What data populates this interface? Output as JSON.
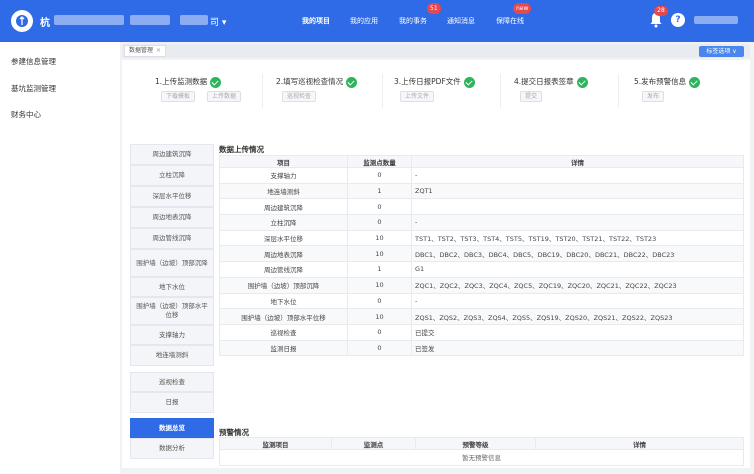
{
  "header": {
    "org_name": "杭",
    "org_suffix": "司 ▾",
    "nav": [
      "我的项目",
      "我的应用",
      "我的事务",
      "通知消息",
      "保障在线"
    ],
    "badges": {
      "affairs": "51",
      "online": "new"
    },
    "bell_count": "28",
    "help": "?"
  },
  "sidebar": {
    "items": [
      "参建信息管理",
      "基坑监测管理",
      "财务中心"
    ]
  },
  "tabs": {
    "active": "数据管理",
    "close": "×",
    "tag_option": "标签选项 ∨"
  },
  "steps": [
    {
      "title": "1.上传监测数据",
      "buttons": [
        "下载模板",
        "上传数据"
      ]
    },
    {
      "title": "2.填写巡视检查情况",
      "buttons": [
        "巡视检查"
      ]
    },
    {
      "title": "3.上传日报PDF文件",
      "buttons": [
        "上传文件"
      ]
    },
    {
      "title": "4.提交日报表签章",
      "buttons": [
        "提交"
      ]
    },
    {
      "title": "5.发布预警信息",
      "buttons": [
        "发布"
      ]
    }
  ],
  "left_menu": [
    "周边建筑沉降",
    "立柱沉降",
    "深层水平位移",
    "周边地表沉降",
    "周边管线沉降",
    "围护墙（边坡）顶部沉降",
    "地下水位",
    "围护墙（边坡）顶部水平位移",
    "支撑轴力",
    "地连墙测斜",
    "巡视检查",
    "日报",
    "数据总览",
    "数据分析"
  ],
  "upload": {
    "title": "数据上传情况",
    "headers": [
      "项目",
      "监测点数量",
      "详情"
    ],
    "rows": [
      [
        "支撑轴力",
        "0",
        "-"
      ],
      [
        "地连墙测斜",
        "1",
        "ZQT1"
      ],
      [
        "周边建筑沉降",
        "0",
        ""
      ],
      [
        "立柱沉降",
        "0",
        "-"
      ],
      [
        "深层水平位移",
        "10",
        "TST1、TST2、TST3、TST4、TST5、TST19、TST20、TST21、TST22、TST23"
      ],
      [
        "周边地表沉降",
        "10",
        "DBC1、DBC2、DBC3、DBC4、DBC5、DBC19、DBC20、DBC21、DBC22、DBC23"
      ],
      [
        "周边管线沉降",
        "1",
        "G1"
      ],
      [
        "围护墙（边坡）顶部沉降",
        "10",
        "ZQC1、ZQC2、ZQC3、ZQC4、ZQC5、ZQC19、ZQC20、ZQC21、ZQC22、ZQC23"
      ],
      [
        "地下水位",
        "0",
        "-"
      ],
      [
        "围护墙（边坡）顶部水平位移",
        "10",
        "ZQS1、ZQS2、ZQS3、ZQS4、ZQS5、ZQS19、ZQS20、ZQS21、ZQS22、ZQS23"
      ],
      [
        "巡视检查",
        "0",
        "已提交"
      ],
      [
        "监测日报",
        "0",
        "已签发"
      ]
    ]
  },
  "warning": {
    "title": "预警情况",
    "headers": [
      "监测项目",
      "监测点",
      "预警等级",
      "详情"
    ],
    "empty": "暂无预警信息"
  },
  "colors": {
    "primary": "#2f6be6",
    "success": "#2db55d",
    "badge": "#e5484d"
  }
}
